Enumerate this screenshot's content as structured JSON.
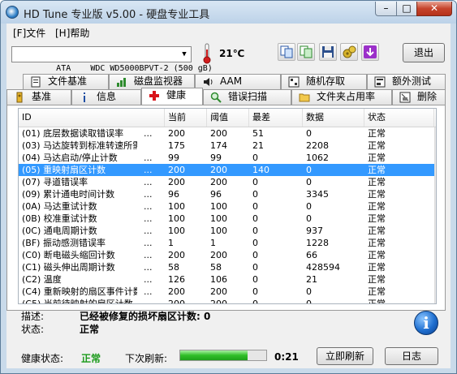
{
  "window": {
    "title": "HD Tune 专业版 v5.00 - 硬盘专业工具"
  },
  "menu": {
    "items": [
      "[F]文件",
      "[H]帮助"
    ]
  },
  "toolbar": {
    "drive": "ATA    WDC WD5000BPVT-2 (500 gB)",
    "temperature": "21℃",
    "exit_label": "退出"
  },
  "tabs": {
    "row1": [
      {
        "label": "文件基准",
        "icon": "file-benchmark-icon"
      },
      {
        "label": "磁盘监视器",
        "icon": "disk-monitor-icon"
      },
      {
        "label": "AAM",
        "icon": "speaker-icon"
      },
      {
        "label": "随机存取",
        "icon": "random-access-icon"
      },
      {
        "label": "额外测试",
        "icon": "extra-tests-icon"
      }
    ],
    "row2": [
      {
        "label": "基准",
        "icon": "benchmark-icon"
      },
      {
        "label": "信息",
        "icon": "info-icon"
      },
      {
        "label": "健康",
        "icon": "health-cross-icon"
      },
      {
        "label": "错误扫描",
        "icon": "magnifier-icon"
      },
      {
        "label": "文件夹占用率",
        "icon": "folder-icon"
      },
      {
        "label": "删除",
        "icon": "erase-icon"
      }
    ],
    "active": "健康"
  },
  "table": {
    "columns": [
      "ID",
      "当前",
      "阈值",
      "最差",
      "数据",
      "状态"
    ],
    "rows": [
      {
        "id": "(01) 底层数据读取错误率",
        "dots": "...",
        "current": "200",
        "threshold": "200",
        "worst": "51",
        "data": "0",
        "status": "正常"
      },
      {
        "id": "(03) 马达旋转到标准转速所需...",
        "dots": "",
        "current": "175",
        "threshold": "174",
        "worst": "21",
        "data": "2208",
        "status": "正常"
      },
      {
        "id": "(04) 马达启动/停止计数",
        "dots": "...",
        "current": "99",
        "threshold": "99",
        "worst": "0",
        "data": "1062",
        "status": "正常"
      },
      {
        "id": "(05) 重映射扇区计数",
        "dots": "...",
        "current": "200",
        "threshold": "200",
        "worst": "140",
        "data": "0",
        "status": "正常"
      },
      {
        "id": "(07) 寻道错误率",
        "dots": "...",
        "current": "200",
        "threshold": "200",
        "worst": "0",
        "data": "0",
        "status": "正常"
      },
      {
        "id": "(09) 累计通电时间计数",
        "dots": "...",
        "current": "96",
        "threshold": "96",
        "worst": "0",
        "data": "3345",
        "status": "正常"
      },
      {
        "id": "(0A) 马达重试计数",
        "dots": "...",
        "current": "100",
        "threshold": "100",
        "worst": "0",
        "data": "0",
        "status": "正常"
      },
      {
        "id": "(0B) 校准重试计数",
        "dots": "...",
        "current": "100",
        "threshold": "100",
        "worst": "0",
        "data": "0",
        "status": "正常"
      },
      {
        "id": "(0C) 通电周期计数",
        "dots": "...",
        "current": "100",
        "threshold": "100",
        "worst": "0",
        "data": "937",
        "status": "正常"
      },
      {
        "id": "(BF) 振动感测错误率",
        "dots": "...",
        "current": "1",
        "threshold": "1",
        "worst": "0",
        "data": "1228",
        "status": "正常"
      },
      {
        "id": "(C0) 断电磁头缩回计数",
        "dots": "...",
        "current": "200",
        "threshold": "200",
        "worst": "0",
        "data": "66",
        "status": "正常"
      },
      {
        "id": "(C1) 磁头伸出周期计数",
        "dots": "...",
        "current": "58",
        "threshold": "58",
        "worst": "0",
        "data": "428594",
        "status": "正常"
      },
      {
        "id": "(C2) 温度",
        "dots": "...",
        "current": "126",
        "threshold": "106",
        "worst": "0",
        "data": "21",
        "status": "正常"
      },
      {
        "id": "(C4) 重新映射的扇区事件计数",
        "dots": "...",
        "current": "200",
        "threshold": "200",
        "worst": "0",
        "data": "0",
        "status": "正常"
      },
      {
        "id": "(C5) 当前待映射的扇区计数",
        "dots": "...",
        "current": "200",
        "threshold": "200",
        "worst": "0",
        "data": "0",
        "status": "正常"
      }
    ],
    "selected_index": 3
  },
  "details": {
    "desc_label": "描述:",
    "desc_value": "已经被修复的损坏扇区计数: 0",
    "status_label": "状态:",
    "status_value": "正常"
  },
  "statusbar": {
    "health_label": "健康状态:",
    "health_value": "正常",
    "refresh_label": "下次刷新:",
    "progress_fraction": 0.78,
    "time": "0:21",
    "refresh_button": "立即刷新",
    "log_button": "日志"
  },
  "colors": {
    "selection": "#3399ff",
    "health_ok": "#1a9a1a"
  }
}
